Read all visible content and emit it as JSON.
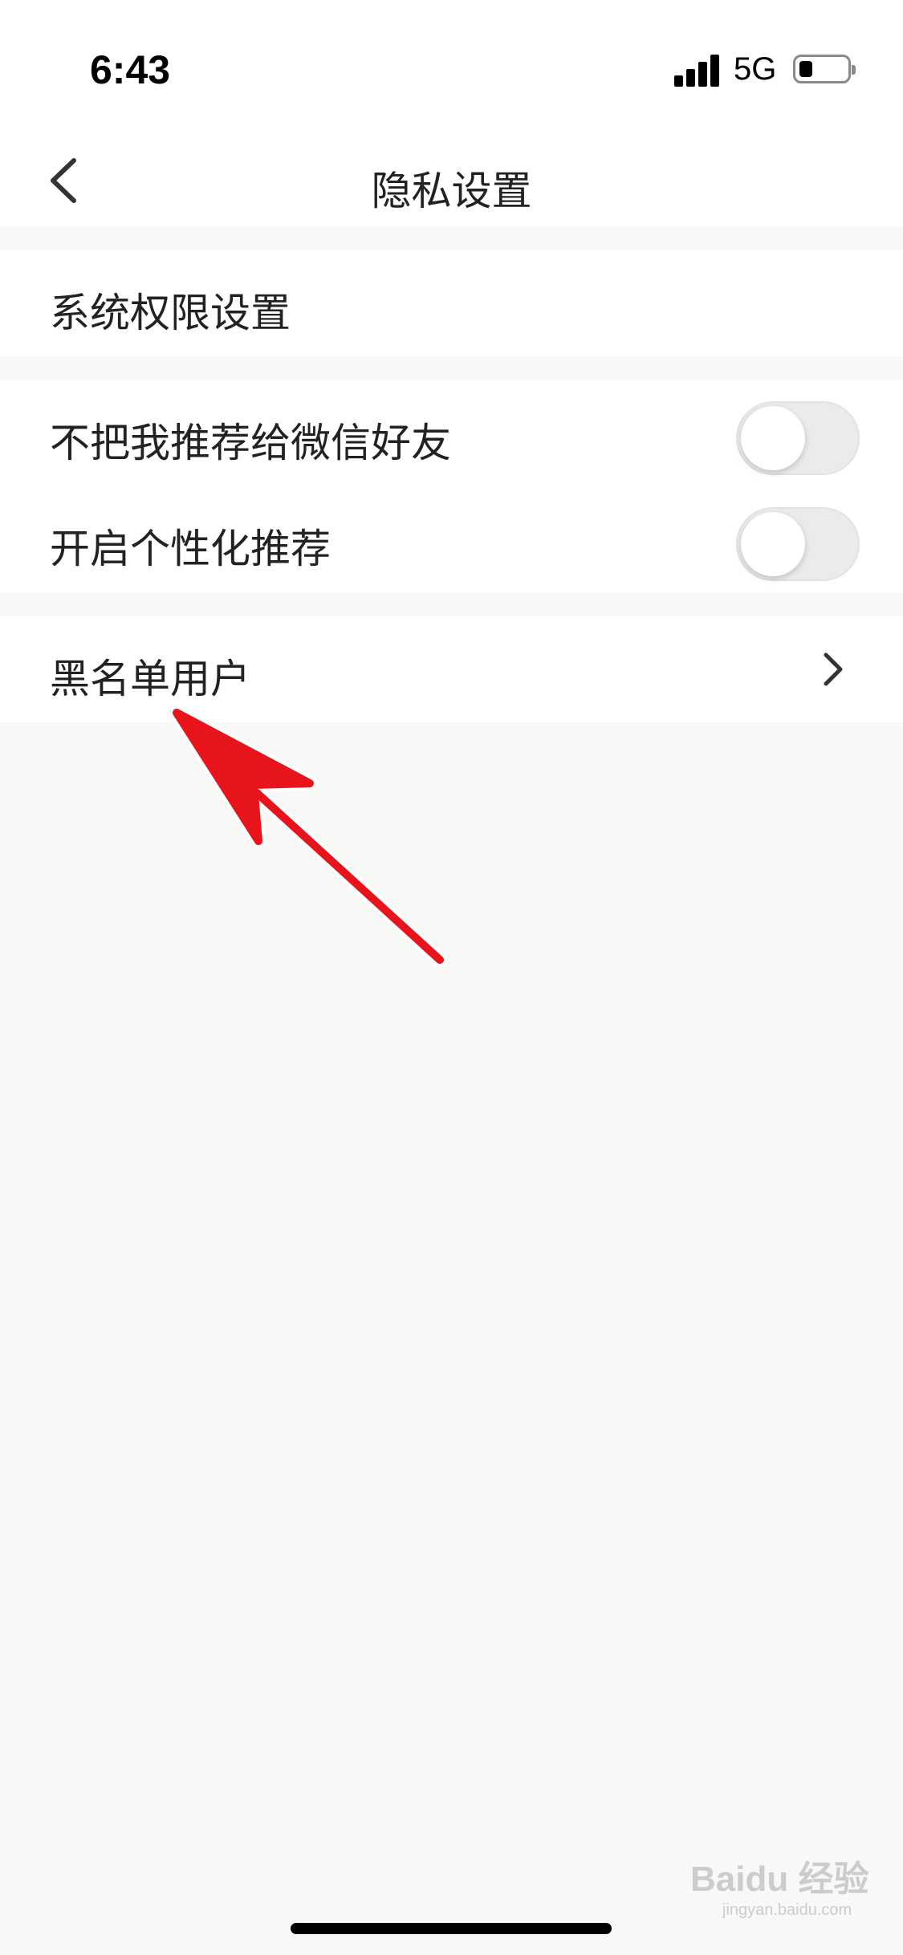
{
  "status_bar": {
    "time": "6:43",
    "network": "5G"
  },
  "nav": {
    "title": "隐私设置"
  },
  "settings": {
    "system_permissions": "系统权限设置",
    "no_recommend_to_wechat": "不把我推荐给微信好友",
    "personalized_recommend": "开启个性化推荐",
    "blocked_users": "黑名单用户"
  },
  "toggles": {
    "no_recommend_to_wechat": false,
    "personalized_recommend": false
  },
  "watermark": {
    "text": "Baidu 经验",
    "sub": "jingyan.baidu.com"
  },
  "colors": {
    "page_background": "#f8f8f6",
    "row_background": "#ffffff",
    "toggle_off": "#ebebeb",
    "annotation_arrow": "#e8141c"
  }
}
